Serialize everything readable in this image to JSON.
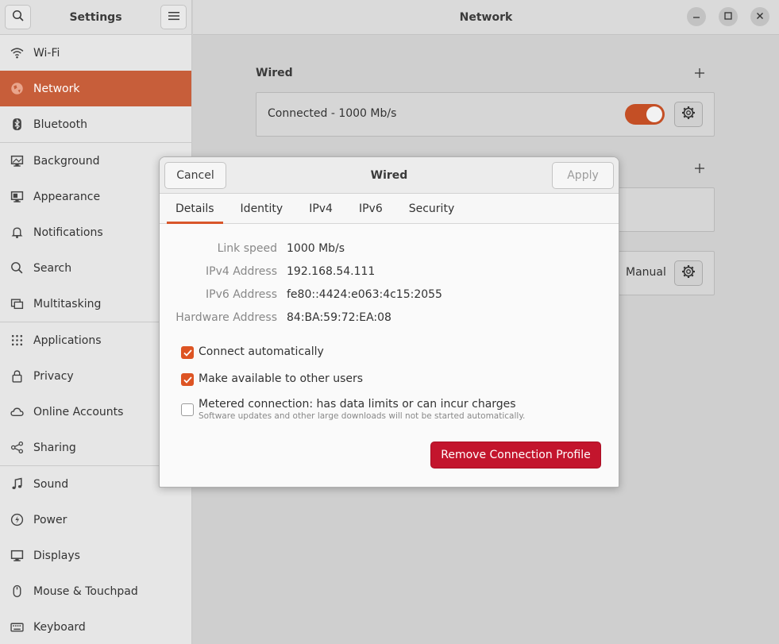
{
  "sidebar": {
    "title": "Settings",
    "items": [
      {
        "label": "Wi-Fi",
        "icon": "wifi-icon"
      },
      {
        "label": "Network",
        "icon": "network-icon",
        "active": true
      },
      {
        "label": "Bluetooth",
        "icon": "bluetooth-icon"
      },
      {
        "label": "Background",
        "icon": "background-icon"
      },
      {
        "label": "Appearance",
        "icon": "appearance-icon"
      },
      {
        "label": "Notifications",
        "icon": "bell-icon"
      },
      {
        "label": "Search",
        "icon": "search-icon"
      },
      {
        "label": "Multitasking",
        "icon": "multitasking-icon"
      },
      {
        "label": "Applications",
        "icon": "apps-grid-icon"
      },
      {
        "label": "Privacy",
        "icon": "lock-icon"
      },
      {
        "label": "Online Accounts",
        "icon": "cloud-icon"
      },
      {
        "label": "Sharing",
        "icon": "share-icon"
      },
      {
        "label": "Sound",
        "icon": "music-note-icon"
      },
      {
        "label": "Power",
        "icon": "power-icon"
      },
      {
        "label": "Displays",
        "icon": "display-icon"
      },
      {
        "label": "Mouse & Touchpad",
        "icon": "mouse-icon"
      },
      {
        "label": "Keyboard",
        "icon": "keyboard-icon"
      }
    ]
  },
  "main": {
    "title": "Network",
    "wired_label": "Wired",
    "wired_status": "Connected - 1000 Mb/s",
    "proxy_value": "Manual"
  },
  "dialog": {
    "title": "Wired",
    "cancel": "Cancel",
    "apply": "Apply",
    "tabs": [
      "Details",
      "Identity",
      "IPv4",
      "IPv6",
      "Security"
    ],
    "details": [
      {
        "key": "Link speed",
        "value": "1000 Mb/s"
      },
      {
        "key": "IPv4 Address",
        "value": "192.168.54.111"
      },
      {
        "key": "IPv6 Address",
        "value": "fe80::4424:e063:4c15:2055"
      },
      {
        "key": "Hardware Address",
        "value": "84:BA:59:72:EA:08"
      }
    ],
    "connect_auto": "Connect automatically",
    "available_users": "Make available to other users",
    "metered": "Metered connection: has data limits or can incur charges",
    "metered_sub": "Software updates and other large downloads will not be started automatically.",
    "remove": "Remove Connection Profile"
  },
  "colors": {
    "accent": "#c75e3a",
    "checkbox": "#dd5423",
    "destructive": "#c3152d"
  }
}
